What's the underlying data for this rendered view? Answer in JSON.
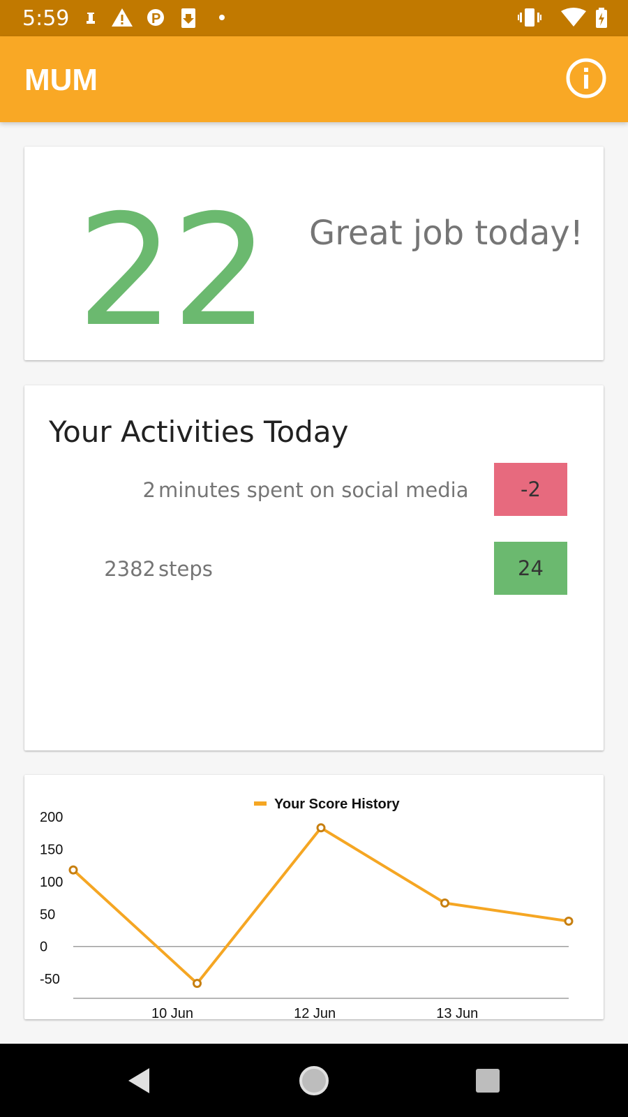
{
  "status_bar": {
    "time": "5:59",
    "left_icons": [
      "chess-rook-icon",
      "warning-icon",
      "parking-icon",
      "download-icon",
      "dot-icon"
    ],
    "right_icons": [
      "vibrate-icon",
      "wifi-icon",
      "battery-charging-icon"
    ]
  },
  "app_bar": {
    "title": "MUM",
    "info_icon": "info-icon"
  },
  "score_card": {
    "score": "22",
    "message": "Great job today!",
    "score_color": "#6bb96f"
  },
  "activities": {
    "title": "Your Activities Today",
    "items": [
      {
        "value": "2",
        "label": "minutes spent on social media",
        "points": "-2",
        "color": "#e76a7e"
      },
      {
        "value": "2382",
        "label": "steps",
        "points": "24",
        "color": "#6bb96f"
      }
    ]
  },
  "chart_data": {
    "type": "line",
    "legend": "Your Score History",
    "legend_position": "top-center",
    "x_ticks": [
      "10 Jun",
      "12 Jun",
      "13 Jun"
    ],
    "series": [
      {
        "name": "Your Score History",
        "color": "#f5a623",
        "values": [
          118,
          -57,
          183,
          67,
          39
        ]
      }
    ],
    "y_ticks": [
      200,
      150,
      100,
      50,
      0,
      -50
    ],
    "ylim": [
      -80,
      200
    ],
    "zero_line": true
  },
  "nav_bar": {
    "icons": [
      "back-icon",
      "home-icon",
      "recents-icon"
    ]
  }
}
